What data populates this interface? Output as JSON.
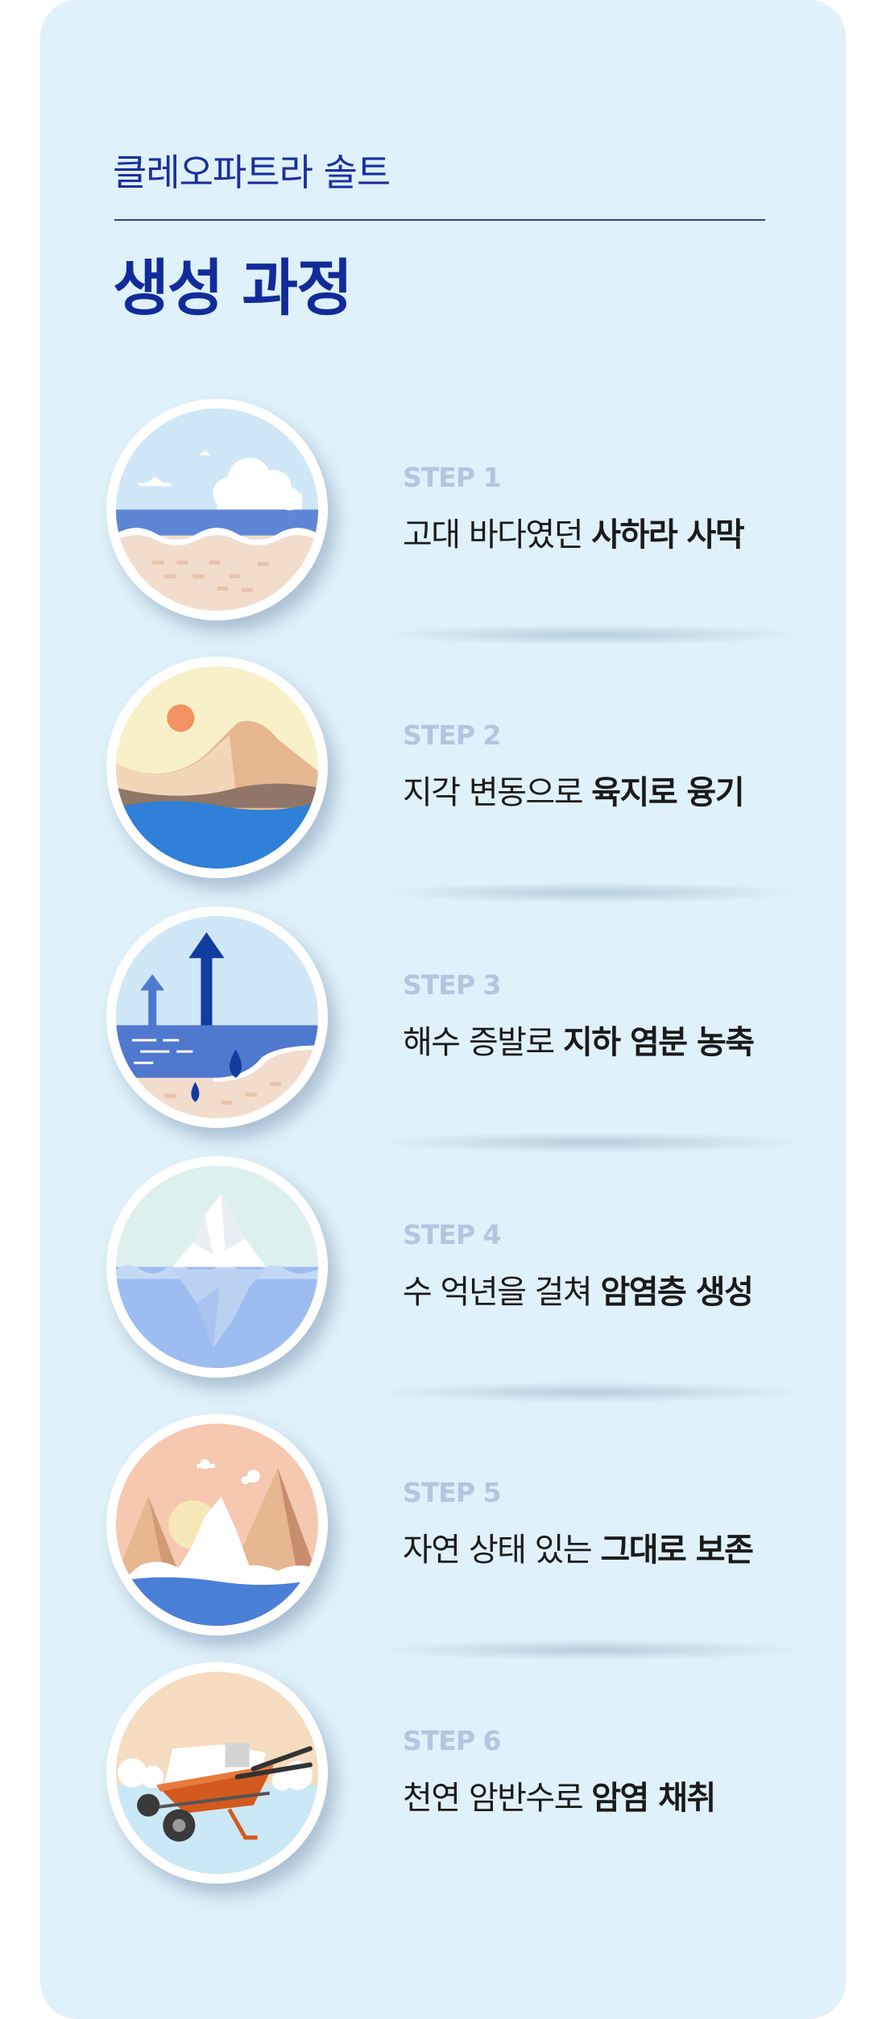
{
  "header": {
    "brand": "클레오파트라 솔트",
    "title": "생성 과정"
  },
  "steps": [
    {
      "label": "STEP 1",
      "text": "고대 바다였던 ",
      "bold": "사하라 사막",
      "icon": "sea-desert-illustration"
    },
    {
      "label": "STEP 2",
      "text": "지각 변동으로 ",
      "bold": "육지로 융기",
      "icon": "mountain-rise-illustration"
    },
    {
      "label": "STEP 3",
      "text": "해수 증발로 ",
      "bold": "지하 염분 농축",
      "icon": "evaporation-illustration"
    },
    {
      "label": "STEP 4",
      "text": "수 억년을 걸쳐 ",
      "bold": "암염층 생성",
      "icon": "salt-crystal-illustration"
    },
    {
      "label": "STEP 5",
      "text": "자연 상태 있는 ",
      "bold": "그대로 보존",
      "icon": "preserved-nature-illustration"
    },
    {
      "label": "STEP 6",
      "text": "천연 암반수로 ",
      "bold": "암염 채취",
      "icon": "wheelbarrow-harvest-illustration"
    }
  ],
  "colors": {
    "background": "#dff1fa",
    "brand": "#1a2f9e",
    "step_label": "#b6c4e0",
    "text": "#1a1a1a"
  }
}
